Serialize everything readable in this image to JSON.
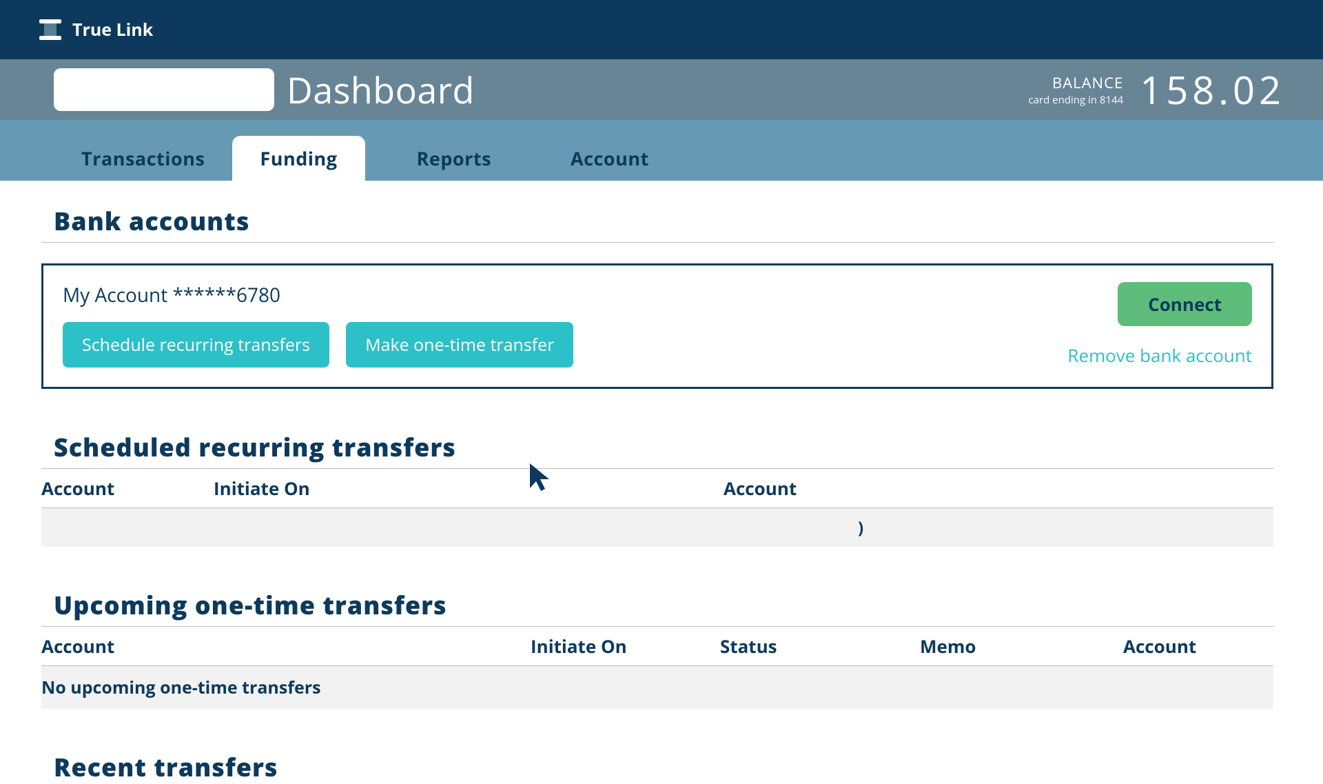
{
  "header": {
    "brand": "True Link"
  },
  "subheader": {
    "page_title": "Dashboard",
    "balance_label": "BALANCE",
    "card_ending": "card ending in 8144",
    "balance_amount": "158.02"
  },
  "tabs": {
    "transactions": "Transactions",
    "funding": "Funding",
    "reports": "Reports",
    "account": "Account"
  },
  "bank_accounts": {
    "section_title": "Bank accounts",
    "account_name": "My Account ******6780",
    "schedule_btn": "Schedule recurring transfers",
    "one_time_btn": "Make one-time transfer",
    "connect_btn": "Connect",
    "remove_link": "Remove bank account"
  },
  "scheduled": {
    "section_title": "Scheduled recurring transfers",
    "col_account1": "Account",
    "col_initiate": "Initiate On",
    "col_account2": "Account",
    "row_marker": ")"
  },
  "upcoming": {
    "section_title": "Upcoming one-time transfers",
    "col_account1": "Account",
    "col_initiate": "Initiate On",
    "col_status": "Status",
    "col_memo": "Memo",
    "col_account2": "Account",
    "empty_message": "No upcoming one-time transfers"
  },
  "recent": {
    "section_title": "Recent transfers"
  }
}
